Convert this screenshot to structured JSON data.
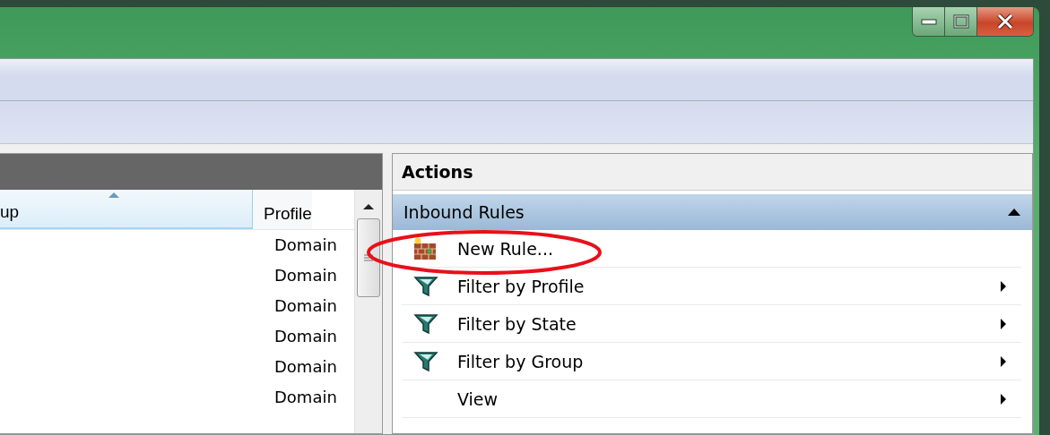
{
  "table": {
    "columns": [
      {
        "label": "up",
        "sorted": true
      },
      {
        "label": "Profile",
        "sorted": false
      }
    ],
    "rows": [
      {
        "profile": "Domain"
      },
      {
        "profile": "Domain"
      },
      {
        "profile": "Domain"
      },
      {
        "profile": "Domain"
      },
      {
        "profile": "Domain"
      },
      {
        "profile": "Domain"
      }
    ]
  },
  "actions": {
    "title": "Actions",
    "section": {
      "title": "Inbound Rules",
      "expanded": true
    },
    "items": [
      {
        "kind": "new-rule",
        "label": "New Rule...",
        "submenu": false,
        "circled": true
      },
      {
        "kind": "filter",
        "label": "Filter by Profile",
        "submenu": true,
        "circled": false
      },
      {
        "kind": "filter",
        "label": "Filter by State",
        "submenu": true,
        "circled": false
      },
      {
        "kind": "filter",
        "label": "Filter by Group",
        "submenu": true,
        "circled": false
      },
      {
        "kind": "plain",
        "label": "View",
        "submenu": true,
        "circled": false
      }
    ]
  }
}
